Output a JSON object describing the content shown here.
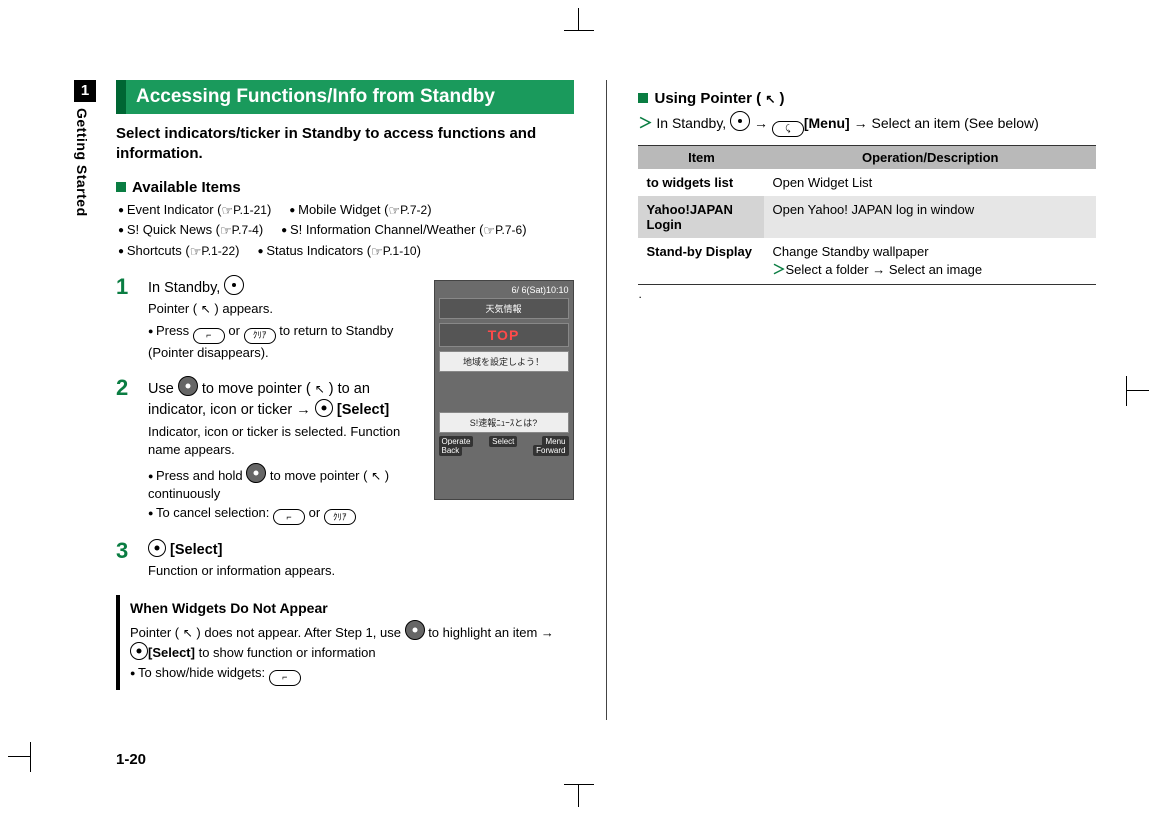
{
  "side_tab": {
    "number": "1",
    "label": "Getting Started"
  },
  "page_number": "1-20",
  "left": {
    "heading": "Accessing Functions/Info from Standby",
    "intro": "Select indicators/ticker in Standby to access functions and information.",
    "available_title": "Available Items",
    "available_items_row1": [
      "Event Indicator (    P.1-21)",
      "Mobile Widget (    P.7-2)"
    ],
    "available_items_row2": [
      "S! Quick News (    P.7-4)",
      "S! Information Channel/Weather (    P.7-6)"
    ],
    "available_items_row3": [
      "Shortcuts (    P.1-22)",
      "Status Indicators (    P.1-10)"
    ],
    "steps": [
      {
        "num": "1",
        "main_pre": "In Standby, ",
        "sub_line": "Pointer (    ) appears.",
        "note1_pre": "Press ",
        "note1_mid": " or ",
        "note1_post": " to return to Standby (Pointer disappears)."
      },
      {
        "num": "2",
        "main_pre": "Use ",
        "main_mid": " to move pointer (    ) to an indicator, icon or ticker → ",
        "select_label": "[Select]",
        "sub_line": "Indicator, icon or ticker is selected. Function name appears.",
        "note1_pre": "Press and hold ",
        "note1_mid": " to move pointer (    ) continuously",
        "note2_pre": "To cancel selection: ",
        "note2_mid": " or "
      },
      {
        "num": "3",
        "select_label": "[Select]",
        "sub_line": "Function or information appears."
      }
    ],
    "notebox": {
      "title": "When Widgets Do Not Appear",
      "line1_pre": "Pointer (    ) does not appear. After Step 1, use ",
      "line1_mid": " to highlight an item → ",
      "line1_select": "[Select]",
      "line1_post": " to show function or information",
      "line2_pre": "To show/hide widgets: "
    },
    "phone": {
      "status": "6/  6(Sat)10:10",
      "items": [
        "天気情報",
        "TOP",
        "地域を設定しよう！",
        "S!速報ﾆｭｰｽとは?"
      ],
      "operate": "Operate",
      "back": "Back",
      "select": "Select",
      "menu": "Menu",
      "forward": "Forward"
    }
  },
  "right": {
    "using_title": "Using Pointer (    )",
    "using_line_pre": "In Standby, ",
    "using_line_arrow": " → ",
    "using_menu": "[Menu]",
    "using_line_post": " → Select an item (See below)",
    "table": {
      "head_item": "Item",
      "head_op": "Operation/Description",
      "rows": [
        {
          "item": "to widgets list",
          "op": "Open Widget List"
        },
        {
          "item": "Yahoo!JAPAN Login",
          "op": "Open Yahoo! JAPAN log in window"
        },
        {
          "item": "Stand-by Display",
          "op_pre": "Change Standby wallpaper",
          "op_sub": "Select a folder → Select an image"
        }
      ]
    },
    "trail": "."
  }
}
